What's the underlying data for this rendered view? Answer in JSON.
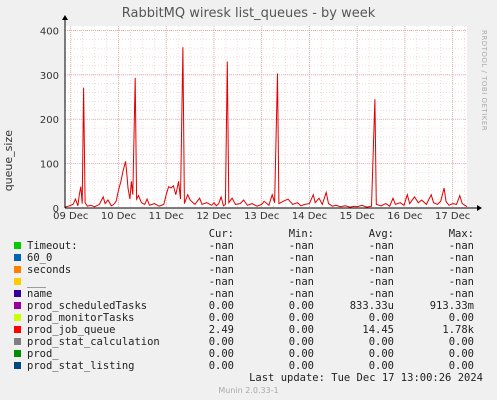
{
  "title": "RabbitMQ wiresk list_queues - by week",
  "side_credit": "RRDTOOL / TOBI OETIKER",
  "chart_data": {
    "type": "line",
    "title": "RabbitMQ wiresk list_queues - by week",
    "ylabel": "queue_size",
    "xlabel": "",
    "ylim": [
      0,
      410
    ],
    "yticks": [
      0,
      100,
      200,
      300,
      400
    ],
    "x_tick_labels": [
      "09 Dec",
      "10 Dec",
      "11 Dec",
      "12 Dec",
      "13 Dec",
      "14 Dec",
      "15 Dec",
      "16 Dec",
      "17 Dec"
    ],
    "x_days": [
      0,
      1,
      2,
      3,
      4,
      5,
      6,
      7,
      8
    ],
    "x_range_days": [
      -0.12,
      8.3
    ],
    "grid": true,
    "series": [
      {
        "name": "prod_job_queue",
        "color": "#e00000",
        "points": [
          [
            -0.12,
            2
          ],
          [
            -0.05,
            4
          ],
          [
            0.0,
            6
          ],
          [
            0.05,
            8
          ],
          [
            0.1,
            20
          ],
          [
            0.15,
            5
          ],
          [
            0.18,
            30
          ],
          [
            0.21,
            48
          ],
          [
            0.24,
            10
          ],
          [
            0.27,
            271
          ],
          [
            0.3,
            12
          ],
          [
            0.35,
            4
          ],
          [
            0.42,
            6
          ],
          [
            0.5,
            3
          ],
          [
            0.6,
            8
          ],
          [
            0.68,
            25
          ],
          [
            0.72,
            10
          ],
          [
            0.78,
            18
          ],
          [
            0.85,
            5
          ],
          [
            0.9,
            8
          ],
          [
            0.95,
            15
          ],
          [
            1.0,
            40
          ],
          [
            1.05,
            60
          ],
          [
            1.1,
            85
          ],
          [
            1.15,
            105
          ],
          [
            1.18,
            70
          ],
          [
            1.2,
            45
          ],
          [
            1.24,
            20
          ],
          [
            1.27,
            60
          ],
          [
            1.3,
            30
          ],
          [
            1.35,
            293
          ],
          [
            1.38,
            20
          ],
          [
            1.42,
            28
          ],
          [
            1.48,
            12
          ],
          [
            1.55,
            8
          ],
          [
            1.6,
            20
          ],
          [
            1.65,
            6
          ],
          [
            1.75,
            10
          ],
          [
            1.85,
            4
          ],
          [
            1.95,
            8
          ],
          [
            2.0,
            30
          ],
          [
            2.05,
            48
          ],
          [
            2.1,
            45
          ],
          [
            2.15,
            50
          ],
          [
            2.2,
            30
          ],
          [
            2.26,
            60
          ],
          [
            2.3,
            20
          ],
          [
            2.35,
            362
          ],
          [
            2.38,
            10
          ],
          [
            2.45,
            30
          ],
          [
            2.5,
            18
          ],
          [
            2.6,
            8
          ],
          [
            2.7,
            22
          ],
          [
            2.75,
            8
          ],
          [
            2.85,
            12
          ],
          [
            2.95,
            6
          ],
          [
            3.0,
            12
          ],
          [
            3.05,
            5
          ],
          [
            3.1,
            10
          ],
          [
            3.15,
            25
          ],
          [
            3.2,
            5
          ],
          [
            3.24,
            8
          ],
          [
            3.28,
            330
          ],
          [
            3.31,
            12
          ],
          [
            3.38,
            22
          ],
          [
            3.45,
            8
          ],
          [
            3.55,
            10
          ],
          [
            3.62,
            18
          ],
          [
            3.7,
            6
          ],
          [
            3.8,
            10
          ],
          [
            3.9,
            4
          ],
          [
            4.0,
            8
          ],
          [
            4.05,
            15
          ],
          [
            4.15,
            6
          ],
          [
            4.22,
            30
          ],
          [
            4.27,
            12
          ],
          [
            4.33,
            303
          ],
          [
            4.36,
            10
          ],
          [
            4.45,
            15
          ],
          [
            4.55,
            20
          ],
          [
            4.65,
            8
          ],
          [
            4.75,
            12
          ],
          [
            4.82,
            5
          ],
          [
            4.9,
            8
          ],
          [
            5.0,
            10
          ],
          [
            5.08,
            30
          ],
          [
            5.12,
            12
          ],
          [
            5.2,
            22
          ],
          [
            5.27,
            8
          ],
          [
            5.35,
            35
          ],
          [
            5.4,
            10
          ],
          [
            5.48,
            4
          ],
          [
            5.55,
            6
          ],
          [
            5.65,
            3
          ],
          [
            5.75,
            5
          ],
          [
            5.85,
            2
          ],
          [
            5.95,
            4
          ],
          [
            6.0,
            3
          ],
          [
            6.1,
            6
          ],
          [
            6.2,
            2
          ],
          [
            6.3,
            4
          ],
          [
            6.37,
            245
          ],
          [
            6.4,
            8
          ],
          [
            6.5,
            5
          ],
          [
            6.6,
            10
          ],
          [
            6.68,
            4
          ],
          [
            6.75,
            22
          ],
          [
            6.8,
            8
          ],
          [
            6.9,
            12
          ],
          [
            6.98,
            6
          ],
          [
            7.05,
            30
          ],
          [
            7.1,
            10
          ],
          [
            7.2,
            25
          ],
          [
            7.28,
            12
          ],
          [
            7.35,
            18
          ],
          [
            7.45,
            8
          ],
          [
            7.55,
            30
          ],
          [
            7.6,
            12
          ],
          [
            7.68,
            8
          ],
          [
            7.75,
            15
          ],
          [
            7.82,
            45
          ],
          [
            7.86,
            15
          ],
          [
            7.92,
            6
          ],
          [
            8.0,
            10
          ],
          [
            8.08,
            8
          ],
          [
            8.15,
            28
          ],
          [
            8.2,
            10
          ],
          [
            8.3,
            3
          ]
        ]
      }
    ]
  },
  "legend": {
    "headers": [
      "Cur:",
      "Min:",
      "Avg:",
      "Max:"
    ],
    "rows": [
      {
        "name": "Timeout:",
        "color": "#00cc00",
        "cur": "-nan",
        "min": "-nan",
        "avg": "-nan",
        "max": "-nan"
      },
      {
        "name": "60_0",
        "color": "#0066b3",
        "cur": "-nan",
        "min": "-nan",
        "avg": "-nan",
        "max": "-nan"
      },
      {
        "name": "seconds",
        "color": "#ff8000",
        "cur": "-nan",
        "min": "-nan",
        "avg": "-nan",
        "max": "-nan"
      },
      {
        "name": "___",
        "color": "#ffcc00",
        "cur": "-nan",
        "min": "-nan",
        "avg": "-nan",
        "max": "-nan"
      },
      {
        "name": "name",
        "color": "#330099",
        "cur": "-nan",
        "min": "-nan",
        "avg": "-nan",
        "max": "-nan"
      },
      {
        "name": "prod_scheduledTasks",
        "color": "#990099",
        "cur": "0.00",
        "min": "0.00",
        "avg": "833.33u",
        "max": "913.33m"
      },
      {
        "name": "prod_monitorTasks",
        "color": "#ccff00",
        "cur": "0.00",
        "min": "0.00",
        "avg": "0.00",
        "max": "0.00"
      },
      {
        "name": "prod_job_queue",
        "color": "#ff0000",
        "cur": "2.49",
        "min": "0.00",
        "avg": "14.45",
        "max": "1.78k"
      },
      {
        "name": "prod_stat_calculation",
        "color": "#808080",
        "cur": "0.00",
        "min": "0.00",
        "avg": "0.00",
        "max": "0.00"
      },
      {
        "name": "prod_",
        "color": "#008f00",
        "cur": "0.00",
        "min": "0.00",
        "avg": "0.00",
        "max": "0.00"
      },
      {
        "name": "prod_stat_listing",
        "color": "#00487d",
        "cur": "0.00",
        "min": "0.00",
        "avg": "0.00",
        "max": "0.00"
      }
    ]
  },
  "footer": {
    "last_update": "Last update:  Tue Dec 17 13:00:26 2024"
  },
  "version": "Munin 2.0.33-1"
}
